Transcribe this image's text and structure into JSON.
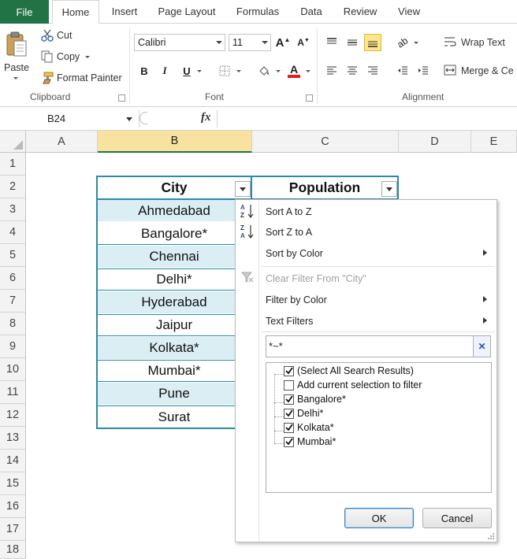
{
  "ribbon": {
    "tabs": [
      {
        "label": "File"
      },
      {
        "label": "Home"
      },
      {
        "label": "Insert"
      },
      {
        "label": "Page Layout"
      },
      {
        "label": "Formulas"
      },
      {
        "label": "Data"
      },
      {
        "label": "Review"
      },
      {
        "label": "View"
      }
    ],
    "clipboard": {
      "paste": "Paste",
      "cut": "Cut",
      "copy": "Copy",
      "format_painter": "Format Painter",
      "group": "Clipboard"
    },
    "font": {
      "name": "Calibri",
      "size": "11",
      "group": "Font",
      "font_color": "#e02020"
    },
    "alignment": {
      "wrap_text": "Wrap Text",
      "merge": "Merge & Ce",
      "group": "Alignment"
    }
  },
  "formula_bar": {
    "name_box": "B24",
    "fx": "fx",
    "content": ""
  },
  "sheet": {
    "columns": [
      "A",
      "B",
      "C",
      "D",
      "E"
    ],
    "rows": [
      "1",
      "2",
      "3",
      "4",
      "5",
      "6",
      "7",
      "8",
      "9",
      "10",
      "11",
      "12",
      "13",
      "14",
      "15",
      "16",
      "17",
      "18"
    ],
    "headers": {
      "city": "City",
      "population": "Population"
    },
    "cities": [
      "Ahmedabad",
      "Bangalore*",
      "Chennai",
      "Delhi*",
      "Hyderabad",
      "Jaipur",
      "Kolkata*",
      "Mumbai*",
      "Pune",
      "Surat"
    ],
    "colors": {
      "band": "#dbeef4",
      "table_border": "#2b8aa6",
      "selected_header": "#f7e39f"
    }
  },
  "filter_menu": {
    "sort_az": "Sort A to Z",
    "sort_za": "Sort Z to A",
    "sort_by_color": "Sort by Color",
    "clear_filter": "Clear Filter From \"City\"",
    "filter_by_color": "Filter by Color",
    "text_filters": "Text Filters",
    "search_value": "*~*",
    "items": [
      {
        "label": "(Select All Search Results)",
        "checked": true
      },
      {
        "label": "Add current selection to filter",
        "checked": false
      },
      {
        "label": "Bangalore*",
        "checked": true
      },
      {
        "label": "Delhi*",
        "checked": true
      },
      {
        "label": "Kolkata*",
        "checked": true
      },
      {
        "label": "Mumbai*",
        "checked": true
      }
    ],
    "ok": "OK",
    "cancel": "Cancel"
  }
}
